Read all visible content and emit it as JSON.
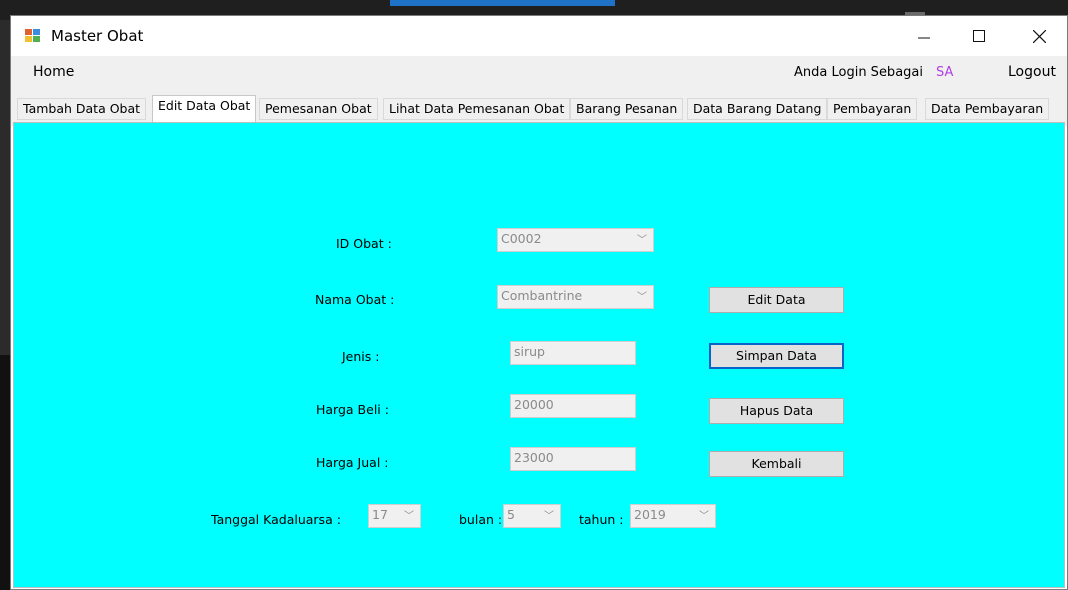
{
  "window": {
    "title": "Master Obat"
  },
  "menu": {
    "home": "Home",
    "login_label": "Anda Login Sebagai",
    "login_user": "SA",
    "logout": "Logout"
  },
  "tabs": [
    {
      "label": "Tambah Data Obat"
    },
    {
      "label": "Edit Data Obat",
      "active": true
    },
    {
      "label": "Pemesanan Obat"
    },
    {
      "label": "Lihat Data Pemesanan Obat"
    },
    {
      "label": "Barang Pesanan"
    },
    {
      "label": "Data Barang Datang"
    },
    {
      "label": "Pembayaran"
    },
    {
      "label": "Data Pembayaran"
    }
  ],
  "form": {
    "id_obat": {
      "label": "ID Obat :",
      "value": "C0002"
    },
    "nama_obat": {
      "label": "Nama Obat :",
      "value": "Combantrine"
    },
    "jenis": {
      "label": "Jenis :",
      "value": "sirup"
    },
    "harga_beli": {
      "label": "Harga Beli :",
      "value": "20000"
    },
    "harga_jual": {
      "label": "Harga Jual :",
      "value": "23000"
    },
    "tanggal": {
      "label": "Tanggal Kadaluarsa :",
      "value": "17"
    },
    "bulan": {
      "label": "bulan :",
      "value": "5"
    },
    "tahun": {
      "label": "tahun :",
      "value": "2019"
    }
  },
  "buttons": {
    "edit": "Edit Data",
    "simpan": "Simpan Data",
    "hapus": "Hapus Data",
    "kembali": "Kembali"
  },
  "icons": {
    "dropdown": "chevron-down-icon",
    "minimize": "minimize-icon",
    "maximize": "maximize-icon",
    "close": "close-icon",
    "app": "app-icon"
  },
  "colors": {
    "panel": "#00ffff",
    "user": "#b040e0",
    "focus": "#0a64c8"
  }
}
